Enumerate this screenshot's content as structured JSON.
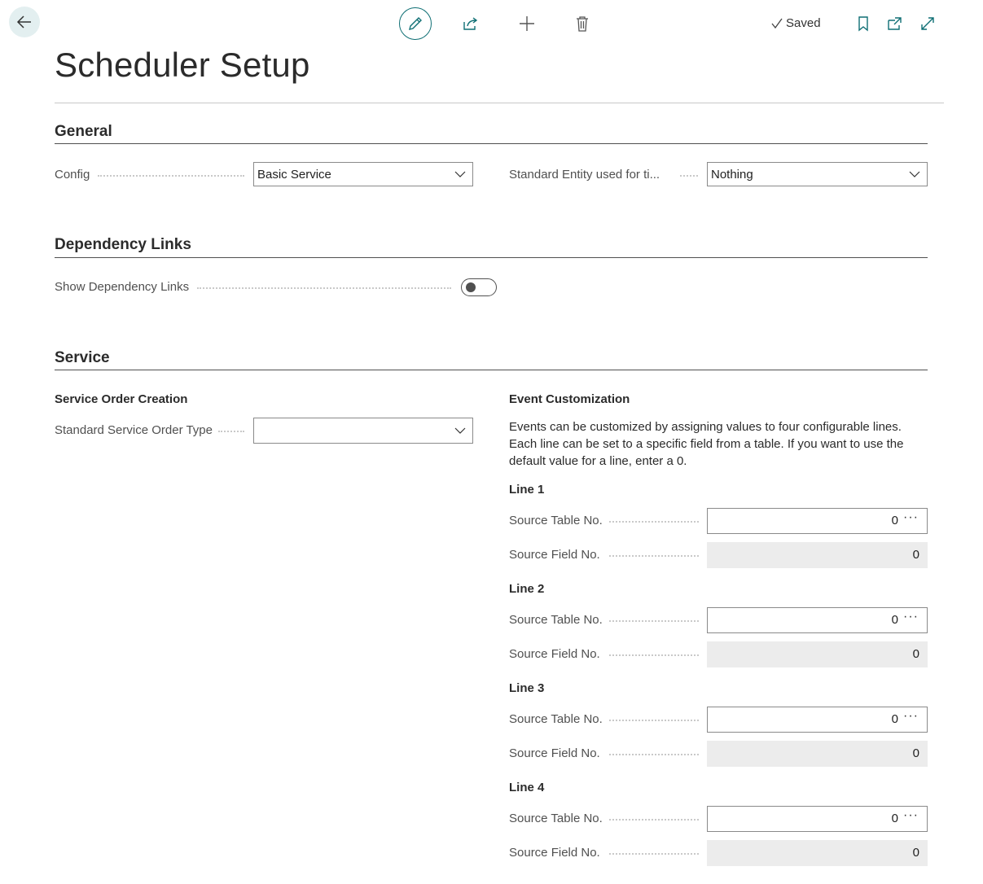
{
  "header": {
    "saved_label": "Saved",
    "page_title": "Scheduler Setup"
  },
  "sections": {
    "general": {
      "title": "General",
      "config_label": "Config",
      "config_value": "Basic Service",
      "std_entity_label": "Standard Entity used for ti...",
      "std_entity_value": "Nothing"
    },
    "dependency": {
      "title": "Dependency Links",
      "show_label": "Show Dependency Links",
      "show_value": false
    },
    "service": {
      "title": "Service",
      "order_creation_title": "Service Order Creation",
      "std_order_type_label": "Standard Service Order Type",
      "std_order_type_value": "",
      "event_title": "Event Customization",
      "event_desc": "Events can be customized by assigning values to four configurable lines. Each line can be set to a specific field from a table. If you want to use the default value for a line, enter a 0.",
      "lines": [
        {
          "title": "Line 1",
          "table_label": "Source Table No.",
          "table_value": "0",
          "field_label": "Source Field No.",
          "field_value": "0"
        },
        {
          "title": "Line 2",
          "table_label": "Source Table No.",
          "table_value": "0",
          "field_label": "Source Field No.",
          "field_value": "0"
        },
        {
          "title": "Line 3",
          "table_label": "Source Table No.",
          "table_value": "0",
          "field_label": "Source Field No.",
          "field_value": "0"
        },
        {
          "title": "Line 4",
          "table_label": "Source Table No.",
          "table_value": "0",
          "field_label": "Source Field No.",
          "field_value": "0"
        }
      ],
      "lookup_glyph": "···"
    }
  },
  "colors": {
    "accent": "#0f6f74",
    "back_bg": "#e3eff0",
    "readonly_bg": "#ececec"
  }
}
